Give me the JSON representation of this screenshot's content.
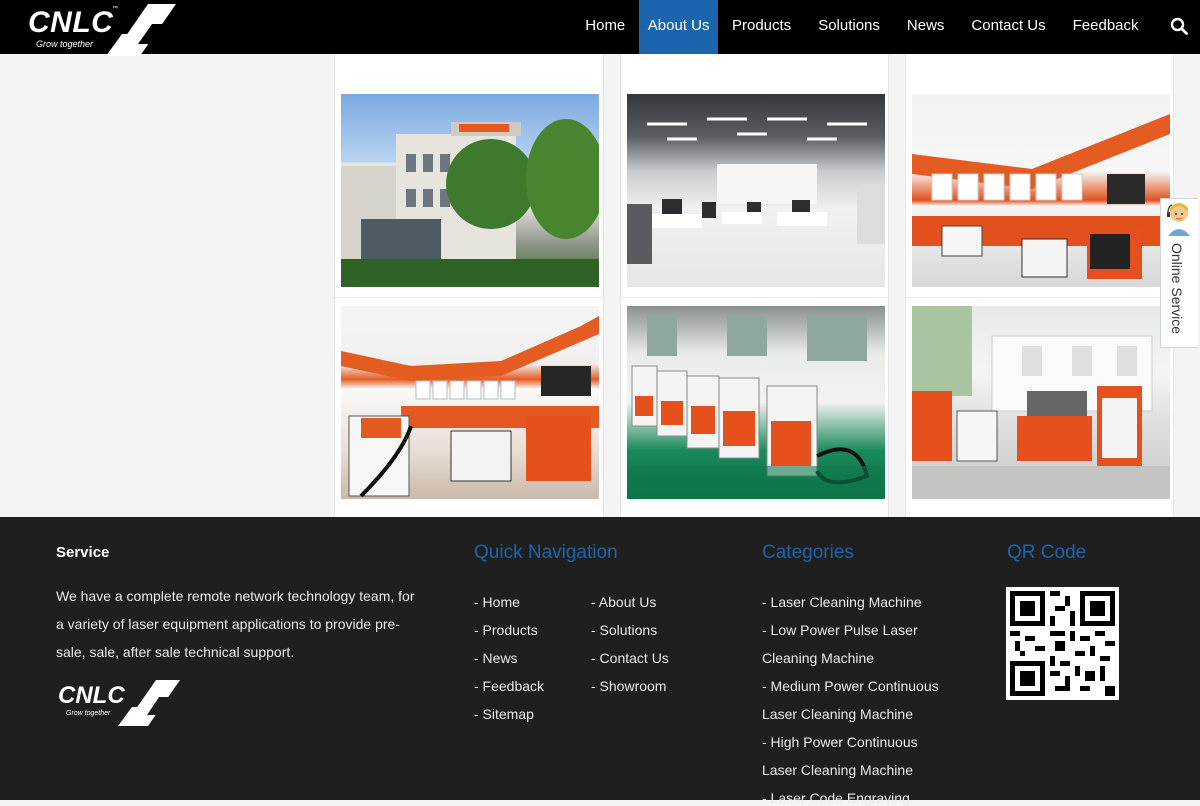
{
  "header": {
    "logo_text": "CNLC",
    "logo_tagline": "Grow together",
    "logo_tm": "™",
    "nav": [
      {
        "label": "Home"
      },
      {
        "label": "About Us",
        "active": true
      },
      {
        "label": "Products"
      },
      {
        "label": "Solutions"
      },
      {
        "label": "News"
      },
      {
        "label": "Contact Us"
      },
      {
        "label": "Feedback"
      }
    ],
    "search_icon": "search-icon"
  },
  "gallery": {
    "photos": [
      {
        "subject": "company-building"
      },
      {
        "subject": "office-interior"
      },
      {
        "subject": "showroom"
      },
      {
        "subject": "showroom-machines"
      },
      {
        "subject": "factory-production-line"
      },
      {
        "subject": "workshop-machines"
      }
    ]
  },
  "footer": {
    "service": {
      "title": "Service",
      "text": "We have a complete remote network technology team, for a variety of laser equipment applications to provide pre-sale, sale, after sale technical support.",
      "logo_text": "CNLC",
      "logo_tagline": "Grow together"
    },
    "quick_nav": {
      "title": "Quick Navigation",
      "left": [
        "- Home",
        "- Products",
        "- News",
        "- Feedback",
        "- Sitemap"
      ],
      "right": [
        "- About Us",
        "- Solutions",
        "- Contact Us",
        "- Showroom"
      ]
    },
    "categories": {
      "title": "Categories",
      "lines": [
        "- Laser Cleaning Machine",
        "- Low Power Pulse Laser",
        "Cleaning Machine",
        "- Medium Power Continuous",
        "Laser Cleaning Machine",
        "- High Power Continuous",
        "Laser Cleaning Machine",
        "- Laser Code Engraving"
      ]
    },
    "qr": {
      "title": "QR Code"
    }
  },
  "online_service": {
    "label": "Online Service"
  },
  "colors": {
    "header_bg": "#000000",
    "accent_blue": "#1a65ae",
    "footer_bg": "#1f1f1f",
    "brand_orange": "#e2511d"
  }
}
